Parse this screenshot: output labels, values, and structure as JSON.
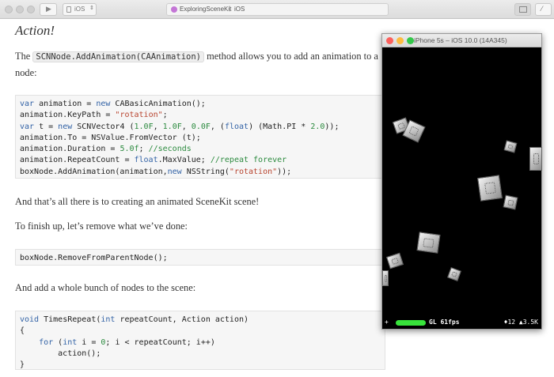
{
  "toolbar": {
    "platform": "iOS",
    "project": "ExploringSceneKit",
    "target": "iOS"
  },
  "doc": {
    "title": "Action!",
    "intro_pre": "The ",
    "intro_code": "SCNNode.AddAnimation(CAAnimation)",
    "intro_post": " method allows you to add an animation to a",
    "intro_line2": "node:",
    "para2": "And that’s all there is to creating an animated SceneKit scene!",
    "para3": "To finish up, let’s remove what we’ve done:",
    "code2": "boxNode.RemoveFromParentNode();",
    "para4": "And add a whole bunch of nodes to the scene:"
  },
  "simulator": {
    "title": "iPhone 5s – iOS 10.0 (14A345)",
    "fps": "GL 61fps",
    "nodes": "♦12 ▲3.5K",
    "stats_icon": "plus-icon"
  },
  "colors": {
    "keyword": "#3363a6",
    "string": "#b8442f",
    "number": "#2b8a3e",
    "fps_bar": "#38e33b"
  }
}
